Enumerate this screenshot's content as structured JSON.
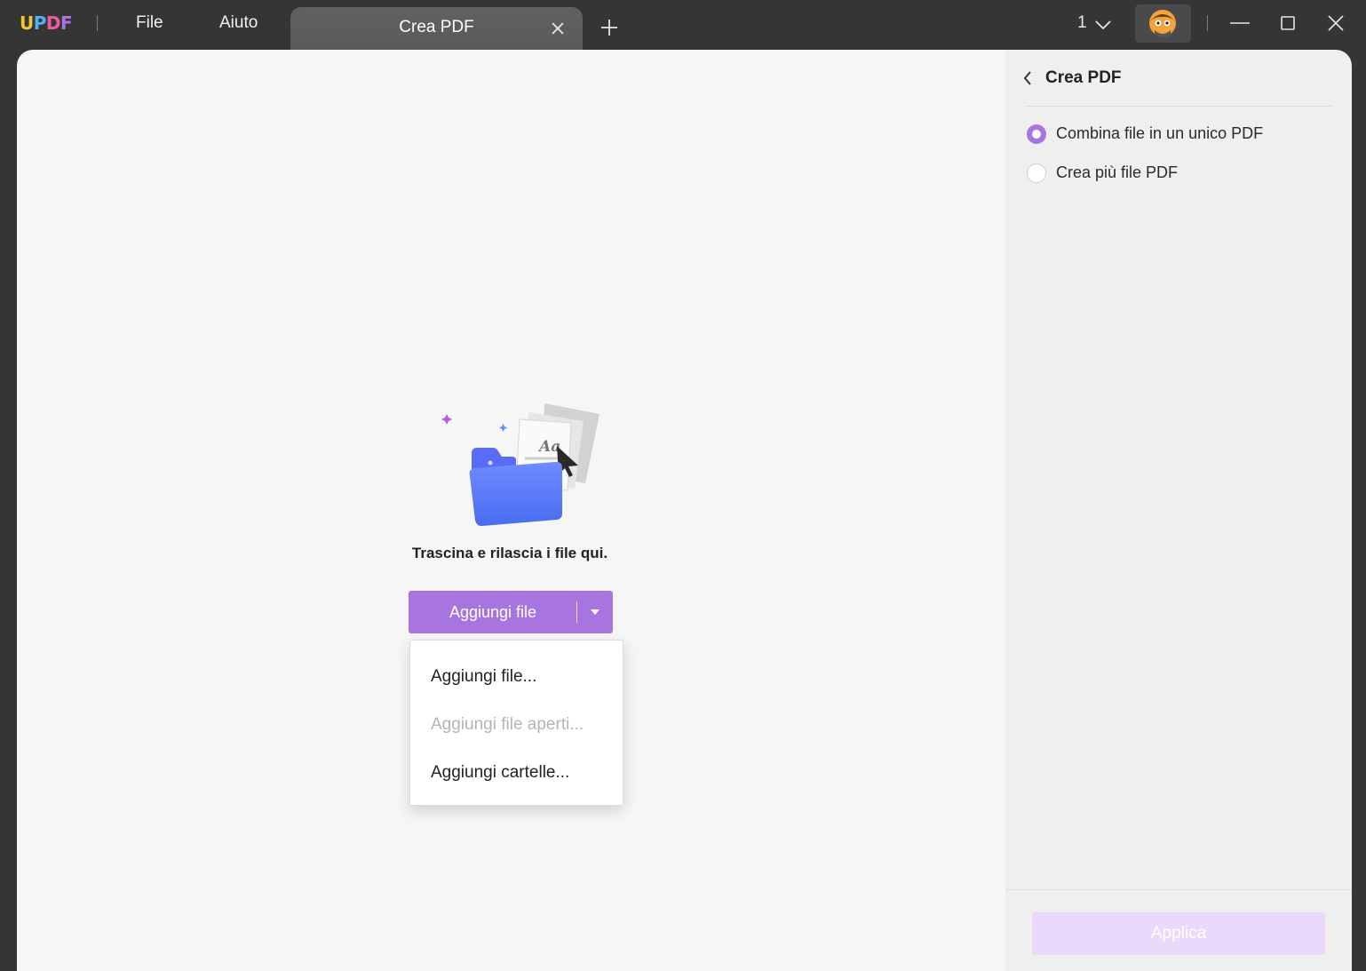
{
  "app": {
    "logo_letters": [
      {
        "char": "U",
        "color": "#f6c431"
      },
      {
        "char": "P",
        "color": "#4fb1f2"
      },
      {
        "char": "D",
        "color": "#ec5aa0"
      },
      {
        "char": "F",
        "color": "#a774e0"
      }
    ],
    "menu": {
      "file": "File",
      "help": "Aiuto"
    },
    "tab_title": "Crea PDF",
    "page_indicator": "1"
  },
  "main": {
    "drop_text": "Trascina e rilascia i file qui.",
    "add_button_label": "Aggiungi file",
    "dropdown": [
      {
        "label": "Aggiungi file...",
        "enabled": true
      },
      {
        "label": "Aggiungi file aperti...",
        "enabled": false
      },
      {
        "label": "Aggiungi cartelle...",
        "enabled": true
      }
    ]
  },
  "panel": {
    "title": "Crea PDF",
    "options": [
      {
        "label": "Combina file in un unico PDF",
        "selected": true
      },
      {
        "label": "Crea più file PDF",
        "selected": false
      }
    ],
    "apply_label": "Applica"
  },
  "colors": {
    "accent": "#a774e0",
    "apply_disabled": "#ead9fb",
    "titlebar": "#353535"
  }
}
